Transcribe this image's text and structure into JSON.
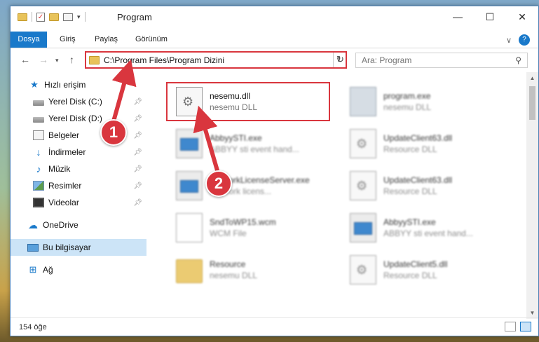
{
  "window": {
    "title": "Program",
    "controls": {
      "minimize": "—",
      "maximize": "☐",
      "close": "✕"
    }
  },
  "ribbon": {
    "tabs": [
      "Dosya",
      "Giriş",
      "Paylaş",
      "Görünüm"
    ],
    "expand": "∨",
    "help": "?"
  },
  "address": {
    "path": "C:\\Program Files\\Program Dizini",
    "search_placeholder": "Ara: Program"
  },
  "sidebar": {
    "items": [
      {
        "label": "Hızlı erişim",
        "icon": "star-icon",
        "pinned": false
      },
      {
        "label": "Yerel Disk (C:)",
        "icon": "drive-icon",
        "pinned": true
      },
      {
        "label": "Yerel Disk (D:)",
        "icon": "drive-icon",
        "pinned": true
      },
      {
        "label": "Belgeler",
        "icon": "documents-icon",
        "pinned": true
      },
      {
        "label": "İndirmeler",
        "icon": "download-icon",
        "pinned": true
      },
      {
        "label": "Müzik",
        "icon": "music-icon",
        "pinned": true
      },
      {
        "label": "Resimler",
        "icon": "pictures-icon",
        "pinned": true
      },
      {
        "label": "Videolar",
        "icon": "videos-icon",
        "pinned": true
      },
      {
        "label": "OneDrive",
        "icon": "cloud-icon",
        "pinned": false
      },
      {
        "label": "Bu bilgisayar",
        "icon": "computer-icon",
        "pinned": false,
        "selected": true
      },
      {
        "label": "Ağ",
        "icon": "network-icon",
        "pinned": false
      }
    ]
  },
  "files": [
    {
      "name": "nesemu.dll",
      "type": "nesemu DLL",
      "icon": "dll-icon",
      "highlighted": true
    },
    {
      "name": "program.exe",
      "type": "nesemu DLL",
      "icon": "program-icon"
    },
    {
      "name": "AbbyySTI.exe",
      "type": "ABBYY sti event hand...",
      "icon": "exe-icon"
    },
    {
      "name": "UpdateClient63.dll",
      "type": "Resource DLL",
      "icon": "dll-icon"
    },
    {
      "name": "NetworkLicenseServer.exe",
      "type": "Network licens...",
      "icon": "exe-icon"
    },
    {
      "name": "UpdateClient63.dll",
      "type": "Resource DLL",
      "icon": "dll-icon"
    },
    {
      "name": "SndToWP15.wcm",
      "type": "WCM File",
      "icon": "file-icon"
    },
    {
      "name": "AbbyySTI.exe",
      "type": "ABBYY sti event hand...",
      "icon": "exe-icon"
    },
    {
      "name": "Resource",
      "type": "nesemu DLL",
      "icon": "folder-icon"
    },
    {
      "name": "UpdateClient5.dll",
      "type": "Resource DLL",
      "icon": "dll-icon"
    }
  ],
  "status": {
    "item_count": "154 öğe"
  },
  "annotations": {
    "step1": "1",
    "step2": "2"
  },
  "colors": {
    "accent": "#1979ca",
    "highlight": "#d9363e",
    "selection": "#cce4f7"
  }
}
